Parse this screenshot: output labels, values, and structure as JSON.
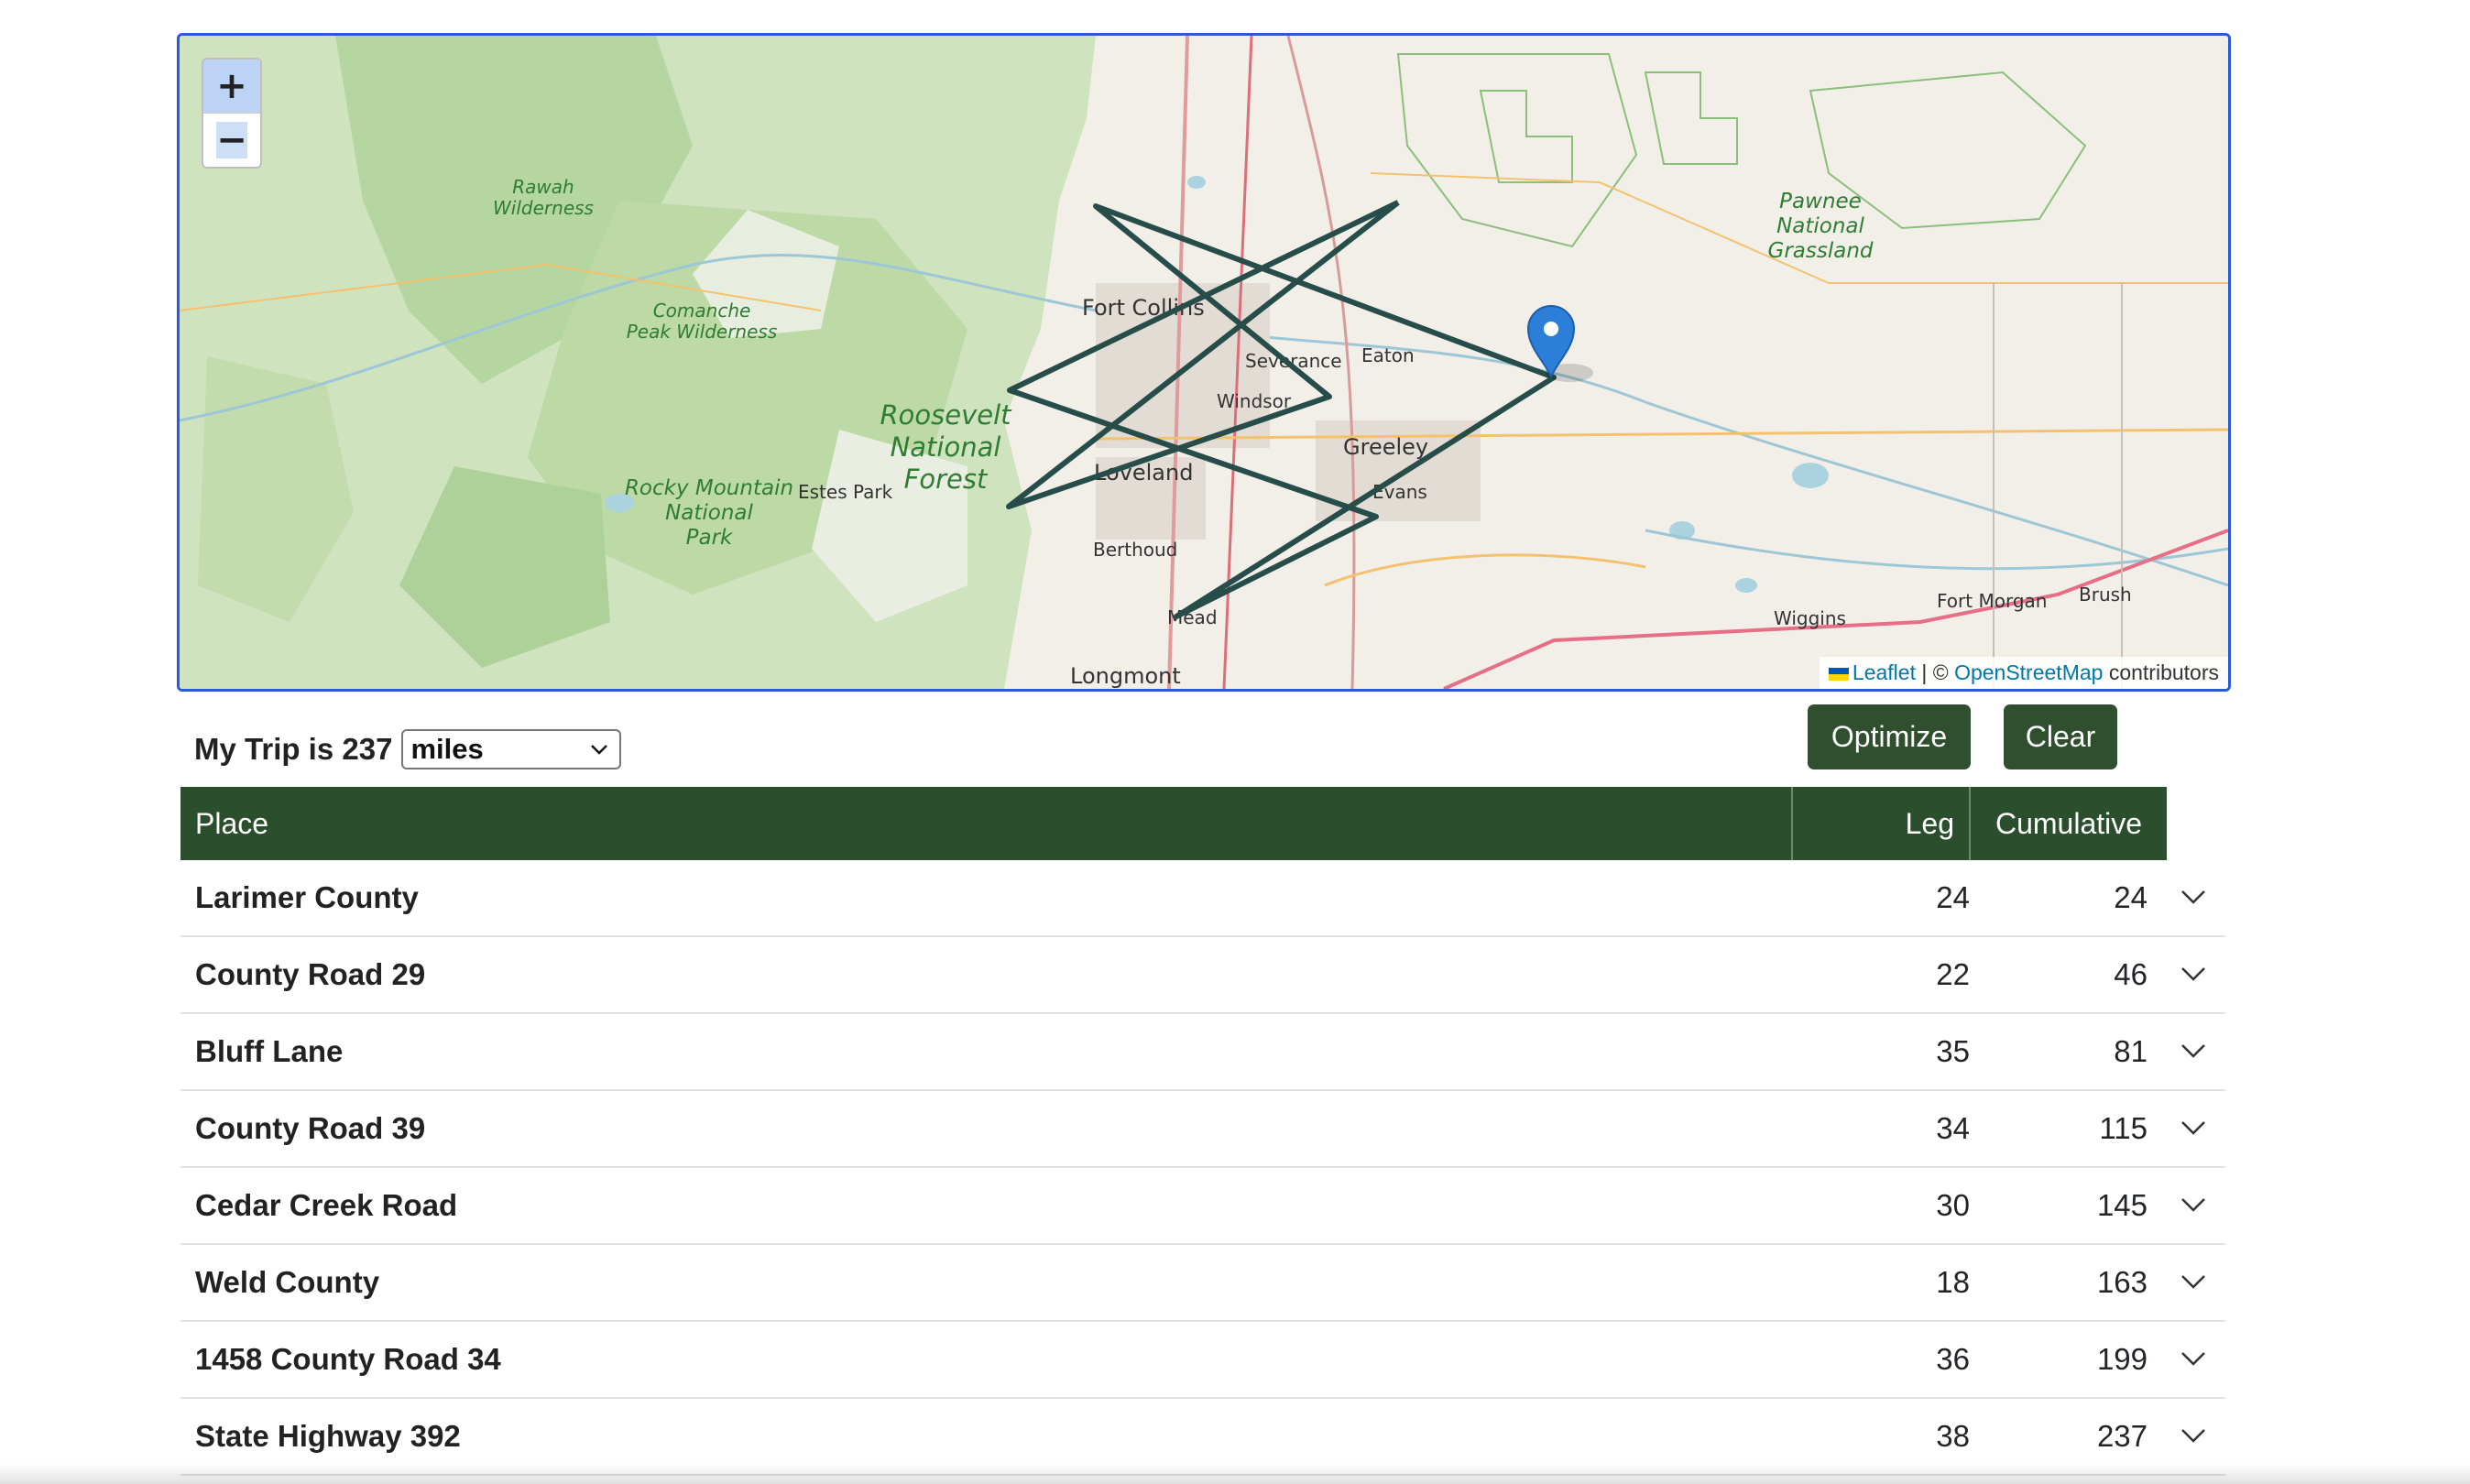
{
  "map": {
    "zoom_in_label": "+",
    "zoom_out_label": "−",
    "attribution": {
      "leaflet": "Leaflet",
      "separator": " | © ",
      "osm": "OpenStreetMap",
      "contributors": " contributors"
    },
    "labels": {
      "fort_collins": "Fort Collins",
      "severance": "Severance",
      "eaton": "Eaton",
      "windsor": "Windsor",
      "greeley": "Greeley",
      "loveland": "Loveland",
      "evans": "Evans",
      "berthoud": "Berthoud",
      "mead": "Mead",
      "longmont": "Longmont",
      "estes_park": "Estes Park",
      "wiggins": "Wiggins",
      "fort_morgan": "Fort Morgan",
      "brush": "Brush",
      "rawah_1": "Rawah",
      "rawah_2": "Wilderness",
      "comanche_1": "Comanche",
      "comanche_2": "Peak Wilderness",
      "roosevelt_1": "Roosevelt",
      "roosevelt_2": "National",
      "roosevelt_3": "Forest",
      "rmnp_1": "Rocky Mountain",
      "rmnp_2": "National",
      "rmnp_3": "Park",
      "pawnee_1": "Pawnee",
      "pawnee_2": "National",
      "pawnee_3": "Grassland"
    },
    "route_color": "#264d4a",
    "marker_color": "#2b7fd8"
  },
  "trip": {
    "title": "My Trip is 237",
    "unit": "miles"
  },
  "buttons": {
    "optimize": "Optimize",
    "clear": "Clear"
  },
  "table": {
    "headers": {
      "place": "Place",
      "leg": "Leg",
      "cumulative": "Cumulative"
    },
    "rows": [
      {
        "place": "Larimer County",
        "leg": "24",
        "cumulative": "24"
      },
      {
        "place": "County Road 29",
        "leg": "22",
        "cumulative": "46"
      },
      {
        "place": "Bluff Lane",
        "leg": "35",
        "cumulative": "81"
      },
      {
        "place": "County Road 39",
        "leg": "34",
        "cumulative": "115"
      },
      {
        "place": "Cedar Creek Road",
        "leg": "30",
        "cumulative": "145"
      },
      {
        "place": "Weld County",
        "leg": "18",
        "cumulative": "163"
      },
      {
        "place": "1458 County Road 34",
        "leg": "36",
        "cumulative": "199"
      },
      {
        "place": "State Highway 392",
        "leg": "38",
        "cumulative": "237"
      }
    ]
  },
  "colors": {
    "header_green": "#2b4e2d",
    "button_green": "#2f4f2f",
    "map_border": "#2a5bd7"
  }
}
